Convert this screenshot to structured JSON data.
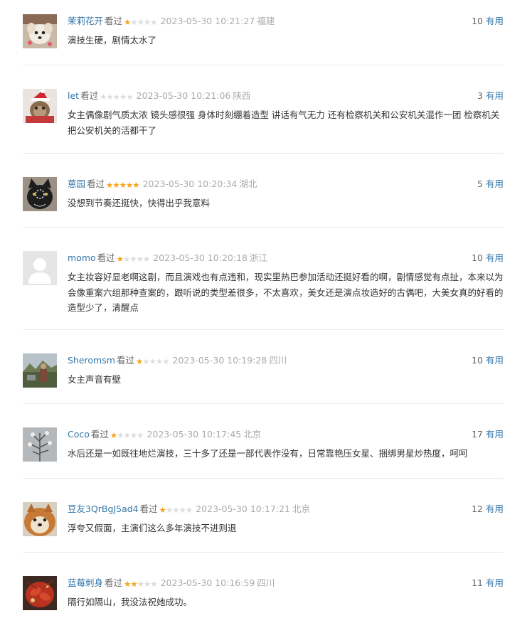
{
  "comments": [
    {
      "user": "茉莉花开",
      "status": "看过",
      "rating": 1,
      "time": "2023-05-30 10:21:27",
      "location": "福建",
      "votes": "10",
      "useful_label": "有用",
      "content": "演技生硬，剧情太水了",
      "avatar": "dog-avatar"
    },
    {
      "user": "let",
      "status": "看过",
      "rating": 0,
      "time": "2023-05-30 10:21:06",
      "location": "陕西",
      "votes": "3",
      "useful_label": "有用",
      "content": "女主偶像剧气质太浓 镜头感很强 身体时刻绷着造型 讲话有气无力 还有检察机关和公安机关混作一团 检察机关把公安机关的活都干了",
      "avatar": "cat-santa-avatar"
    },
    {
      "user": "葸园",
      "status": "看过",
      "rating": 5,
      "time": "2023-05-30 10:20:34",
      "location": "湖北",
      "votes": "5",
      "useful_label": "有用",
      "content": "没想到节奏还挺快，快得出乎我意料",
      "avatar": "black-cat-avatar"
    },
    {
      "user": "momo",
      "status": "看过",
      "rating": 1,
      "time": "2023-05-30 10:20:18",
      "location": "浙江",
      "votes": "10",
      "useful_label": "有用",
      "content": "女主妆容好显老啊这剧，而且演戏也有点违和，现实里热巴参加活动还挺好看的啊，剧情感觉有点扯，本来以为会像重案六组那种查案的，跟听说的类型差很多，不太喜欢，美女还是演点妆造好的古偶吧，大美女真的好看的造型少了，清醒点",
      "avatar": "default-user-avatar"
    },
    {
      "user": "Sheromsm",
      "status": "看过",
      "rating": 1,
      "time": "2023-05-30 10:19:28",
      "location": "四川",
      "votes": "10",
      "useful_label": "有用",
      "content": "女主声音有壁",
      "avatar": "outdoor-avatar"
    },
    {
      "user": "Coco",
      "status": "看过",
      "rating": 1,
      "time": "2023-05-30 10:17:45",
      "location": "北京",
      "votes": "17",
      "useful_label": "有用",
      "content": "水后还是一如既往地烂演技，三十多了还是一部代表作没有，日常靠艳压女星、捆绑男星炒热度，呵呵",
      "avatar": "snow-tree-avatar"
    },
    {
      "user": "豆友3QrBgJ5ad4",
      "status": "看过",
      "rating": 1,
      "time": "2023-05-30 10:17:21",
      "location": "北京",
      "votes": "12",
      "useful_label": "有用",
      "content": "浮夸又假面，主演们这么多年演技不进则退",
      "avatar": "pomeranian-avatar"
    },
    {
      "user": "蓝莓刺身",
      "status": "看过",
      "rating": 2,
      "time": "2023-05-30 10:16:59",
      "location": "四川",
      "votes": "11",
      "useful_label": "有用",
      "content": "隔行如隔山，我没法祝她成功。",
      "avatar": "crayfish-avatar"
    }
  ],
  "colors": {
    "link": "#3377aa",
    "star_on": "#f7a31c",
    "star_off": "#dddddd",
    "meta_gray": "#aaaaaa",
    "divider": "#eaeaea"
  }
}
